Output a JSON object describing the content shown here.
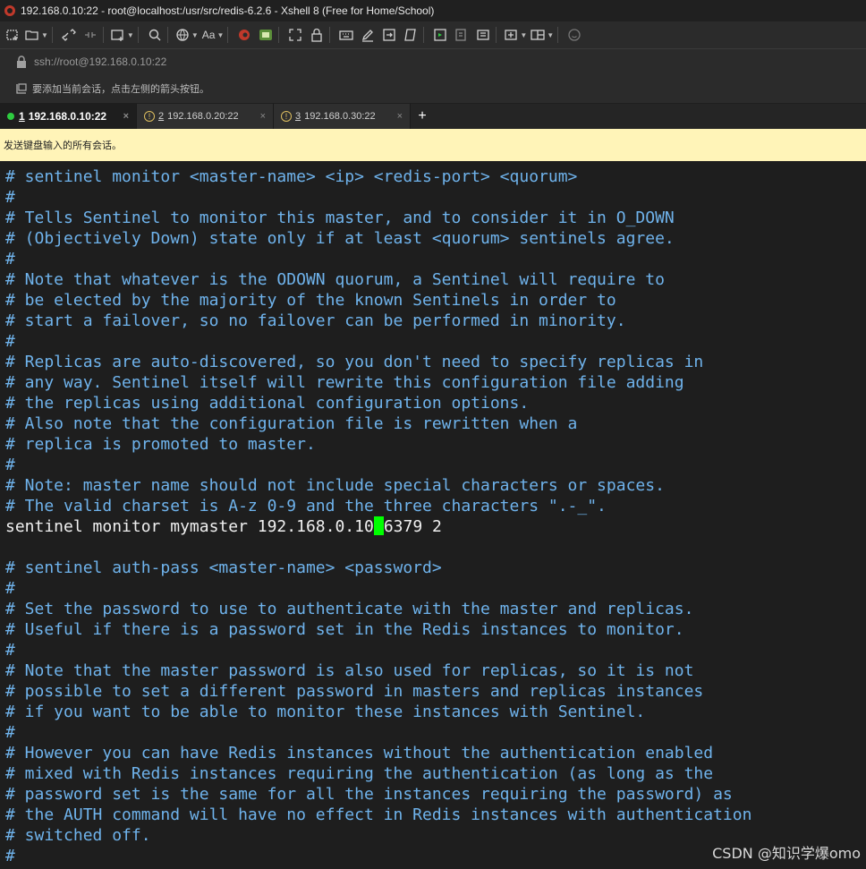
{
  "window": {
    "title": "192.168.0.10:22 - root@localhost:/usr/src/redis-6.2.6 - Xshell 8 (Free for Home/School)"
  },
  "toolbar": {
    "icons": [
      "new-session-icon",
      "open-folder-icon",
      "reconnect-icon",
      "disconnect-icon",
      "new-window-icon",
      "search-icon",
      "globe-icon",
      "font-icon",
      "xshell-logo-icon",
      "xftp-icon",
      "fullscreen-icon",
      "lock-icon",
      "keyboard-icon",
      "compose-icon",
      "transfer-icon",
      "script-icon",
      "compose-bar-icon",
      "log-icon",
      "highlight-icon",
      "add-pane-icon",
      "layout-icon",
      "help-icon"
    ],
    "font_label": "Aa"
  },
  "address": {
    "value": "ssh://root@192.168.0.10:22"
  },
  "hint": {
    "text": "要添加当前会话，点击左侧的箭头按钮。"
  },
  "tabs": [
    {
      "num": "1",
      "label": "192.168.0.10:22",
      "active": true
    },
    {
      "num": "2",
      "label": "192.168.0.20:22",
      "active": false
    },
    {
      "num": "3",
      "label": "192.168.0.30:22",
      "active": false
    }
  ],
  "tab_close": "×",
  "add_tab": "+",
  "banner": {
    "text": "发送键盘输入的所有会话。"
  },
  "terminal": {
    "lines": [
      {
        "type": "comment",
        "text": "# sentinel monitor <master-name> <ip> <redis-port> <quorum>"
      },
      {
        "type": "comment",
        "text": "#"
      },
      {
        "type": "comment",
        "text": "# Tells Sentinel to monitor this master, and to consider it in O_DOWN"
      },
      {
        "type": "comment",
        "text": "# (Objectively Down) state only if at least <quorum> sentinels agree."
      },
      {
        "type": "comment",
        "text": "#"
      },
      {
        "type": "comment",
        "text": "# Note that whatever is the ODOWN quorum, a Sentinel will require to"
      },
      {
        "type": "comment",
        "text": "# be elected by the majority of the known Sentinels in order to"
      },
      {
        "type": "comment",
        "text": "# start a failover, so no failover can be performed in minority."
      },
      {
        "type": "comment",
        "text": "#"
      },
      {
        "type": "comment",
        "text": "# Replicas are auto-discovered, so you don't need to specify replicas in"
      },
      {
        "type": "comment",
        "text": "# any way. Sentinel itself will rewrite this configuration file adding"
      },
      {
        "type": "comment",
        "text": "# the replicas using additional configuration options."
      },
      {
        "type": "comment",
        "text": "# Also note that the configuration file is rewritten when a"
      },
      {
        "type": "comment",
        "text": "# replica is promoted to master."
      },
      {
        "type": "comment",
        "text": "#"
      },
      {
        "type": "comment",
        "text": "# Note: master name should not include special characters or spaces."
      },
      {
        "type": "comment",
        "text": "# The valid charset is A-z 0-9 and the three characters \".-_\"."
      },
      {
        "type": "config",
        "text": "sentinel monitor mymaster 192.168.0.10",
        "after_cursor": "6379 2"
      },
      {
        "type": "blank",
        "text": ""
      },
      {
        "type": "comment",
        "text": "# sentinel auth-pass <master-name> <password>"
      },
      {
        "type": "comment",
        "text": "#"
      },
      {
        "type": "comment",
        "text": "# Set the password to use to authenticate with the master and replicas."
      },
      {
        "type": "comment",
        "text": "# Useful if there is a password set in the Redis instances to monitor."
      },
      {
        "type": "comment",
        "text": "#"
      },
      {
        "type": "comment",
        "text": "# Note that the master password is also used for replicas, so it is not"
      },
      {
        "type": "comment",
        "text": "# possible to set a different password in masters and replicas instances"
      },
      {
        "type": "comment",
        "text": "# if you want to be able to monitor these instances with Sentinel."
      },
      {
        "type": "comment",
        "text": "#"
      },
      {
        "type": "comment",
        "text": "# However you can have Redis instances without the authentication enabled"
      },
      {
        "type": "comment",
        "text": "# mixed with Redis instances requiring the authentication (as long as the"
      },
      {
        "type": "comment",
        "text": "# password set is the same for all the instances requiring the password) as"
      },
      {
        "type": "comment",
        "text": "# the AUTH command will have no effect in Redis instances with authentication"
      },
      {
        "type": "comment",
        "text": "# switched off."
      },
      {
        "type": "comment",
        "text": "#"
      }
    ]
  },
  "watermark": {
    "text": "CSDN @知识学爆omo"
  },
  "colors": {
    "comment": "#6fb3ec",
    "config": "#f0f0f0",
    "cursor": "#00ff00",
    "banner": "#fff4b8",
    "background": "#1e1e1e"
  }
}
